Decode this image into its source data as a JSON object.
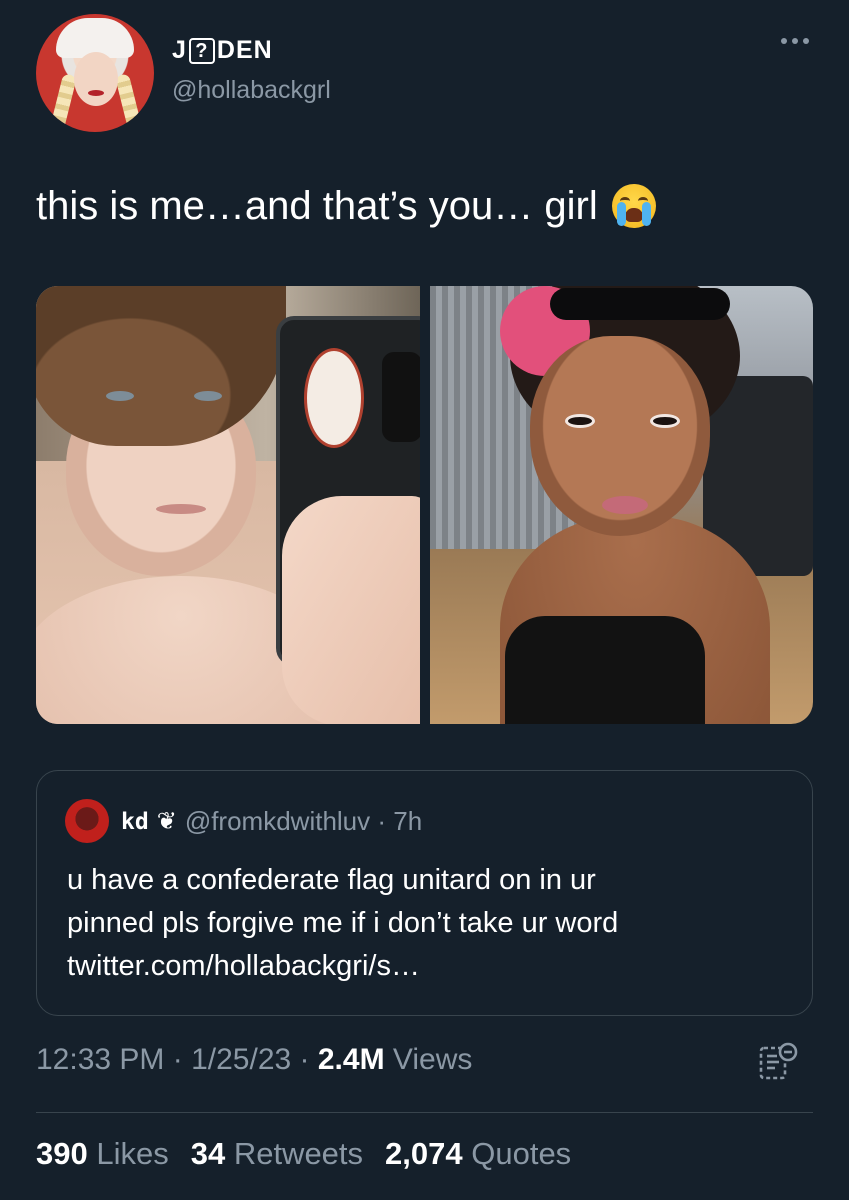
{
  "author": {
    "display_name_pre": "J",
    "display_name_box": "?",
    "display_name_post": "DEN",
    "handle": "@hollabackgrl"
  },
  "tweet": {
    "text": "this is me…and that’s you… girl",
    "emoji": "loudly-crying-face-icon"
  },
  "quote": {
    "name": "kd",
    "name_icon": "❦",
    "handle_time": "@fromkdwithluv · 7h",
    "lines": [
      "u have a confederate flag unitard on in ur",
      "pinned pls forgive me if i don’t take ur word",
      "twitter.com/hollabackgri/s…"
    ]
  },
  "meta": {
    "time": "12:33 PM",
    "sep1": " · ",
    "date": "1/25/23",
    "sep2": " · ",
    "views_count": "2.4M",
    "views_label": " Views"
  },
  "stats": {
    "likes_count": "390",
    "likes_label": " Likes",
    "retweets_count": "34",
    "retweets_label": " Retweets",
    "quotes_count": "2,074",
    "quotes_label": " Quotes"
  },
  "colors": {
    "background": "#15202b",
    "secondary_text": "#8b98a5",
    "border": "#38444d"
  }
}
